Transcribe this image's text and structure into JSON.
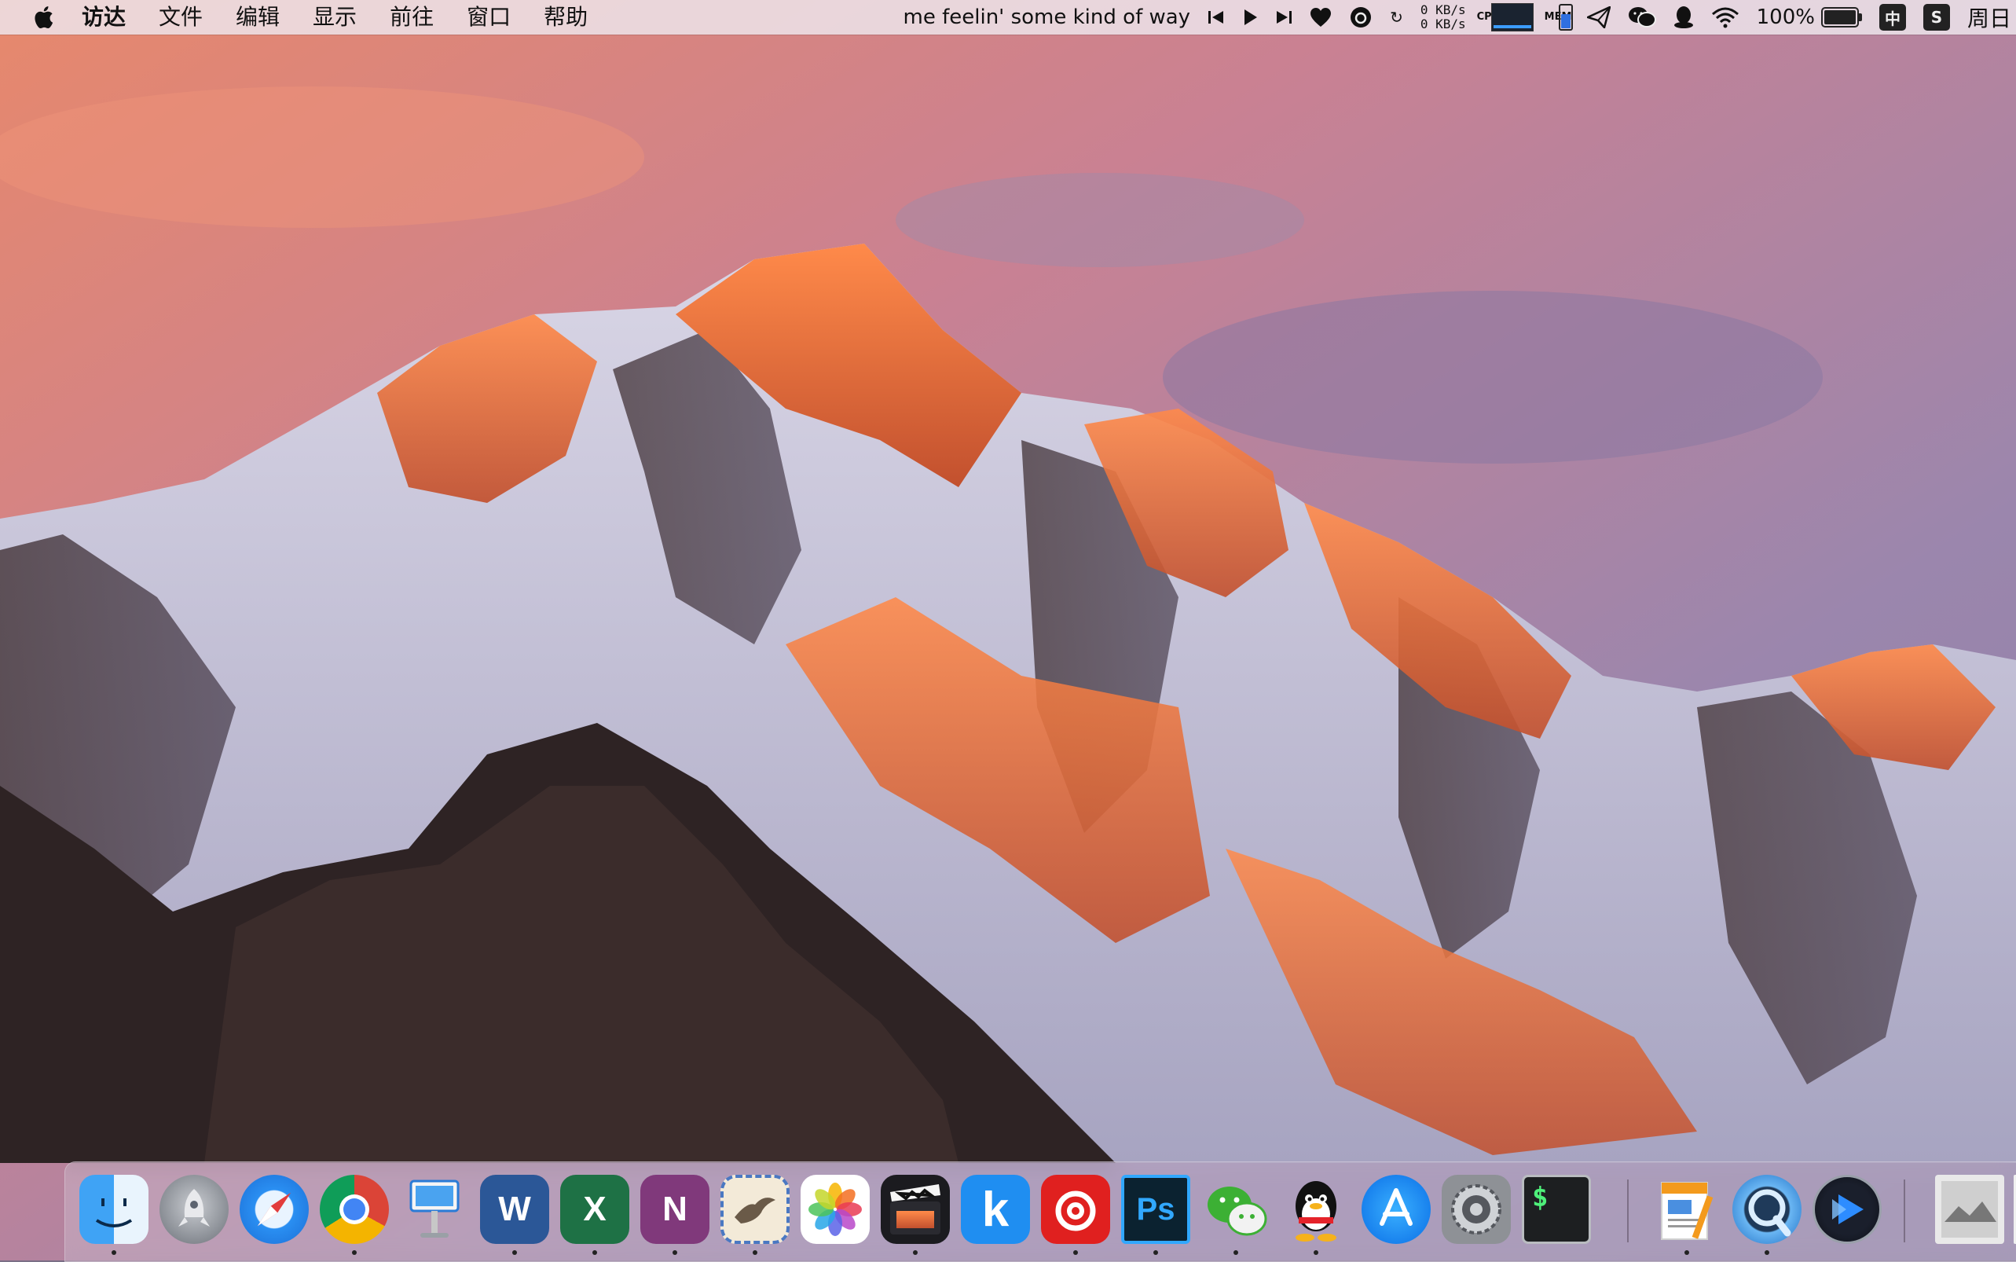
{
  "menubar": {
    "apple_icon": "apple-logo-icon",
    "menus": [
      "访达",
      "文件",
      "编辑",
      "显示",
      "前往",
      "窗口",
      "帮助"
    ],
    "now_playing": "me feelin' some kind of way",
    "net_up": "0 KB/s",
    "net_down": "0 KB/s",
    "cpu_label": "CPU",
    "mem_label": "MEM",
    "battery_percent": "100%",
    "input_method": "中",
    "clock": "周日"
  },
  "dock": {
    "apps": [
      {
        "name": "Finder",
        "icon": "finder-icon",
        "running": true
      },
      {
        "name": "Launchpad",
        "icon": "launchpad-icon",
        "running": false
      },
      {
        "name": "Safari",
        "icon": "safari-icon",
        "running": false
      },
      {
        "name": "Google Chrome",
        "icon": "chrome-icon",
        "running": true
      },
      {
        "name": "Keynote",
        "icon": "keynote-icon",
        "running": false
      },
      {
        "name": "Microsoft Word",
        "icon": "word-icon",
        "running": true
      },
      {
        "name": "Microsoft Excel",
        "icon": "excel-icon",
        "running": true
      },
      {
        "name": "OneNote",
        "icon": "onenote-icon",
        "running": true
      },
      {
        "name": "Mail",
        "icon": "mail-icon",
        "running": true
      },
      {
        "name": "Photos",
        "icon": "photos-icon",
        "running": false
      },
      {
        "name": "Final Cut Pro",
        "icon": "final-cut-icon",
        "running": true
      },
      {
        "name": "Kuaiya",
        "icon": "k-app-icon",
        "running": false
      },
      {
        "name": "NetEase Music",
        "icon": "netease-music-icon",
        "running": true
      },
      {
        "name": "Photoshop",
        "icon": "photoshop-icon",
        "running": true
      },
      {
        "name": "WeChat",
        "icon": "wechat-icon",
        "running": true
      },
      {
        "name": "QQ",
        "icon": "qq-icon",
        "running": true
      },
      {
        "name": "App Store",
        "icon": "app-store-icon",
        "running": false
      },
      {
        "name": "System Preferences",
        "icon": "system-preferences-icon",
        "running": false
      },
      {
        "name": "Terminal",
        "icon": "terminal-icon",
        "running": false
      },
      {
        "name": "Pages",
        "icon": "pages-icon",
        "running": true
      },
      {
        "name": "QuickTime Player",
        "icon": "quicktime-icon",
        "running": true
      },
      {
        "name": "Infuse",
        "icon": "infuse-icon",
        "running": false
      },
      {
        "name": "Downloads",
        "icon": "downloads-stack-icon",
        "running": false
      }
    ],
    "labels": {
      "word": "W",
      "excel": "X",
      "onenote": "N",
      "k_app": "k",
      "photoshop": "Ps",
      "terminal": "$"
    }
  }
}
